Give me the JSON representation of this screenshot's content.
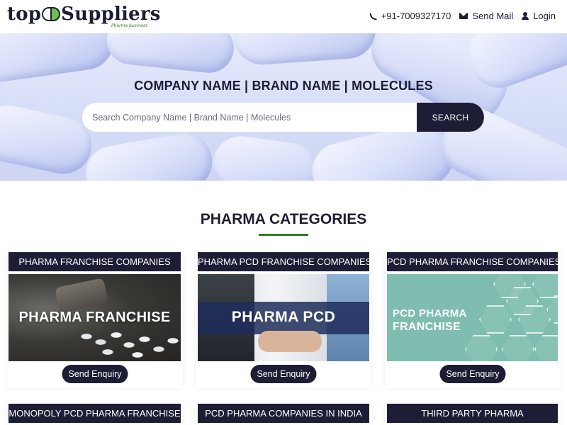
{
  "header": {
    "logo_left": "top",
    "logo_right": "Suppliers",
    "logo_tagline": "Pharma business",
    "phone": "+91-7009327170",
    "mail_label": "Send Mail",
    "login_label": "Login"
  },
  "hero": {
    "title": "COMPANY NAME | BRAND NAME | MOLECULES",
    "search_placeholder": "Search Company Name | Brand Name | Molecules",
    "search_button": "SEARCH"
  },
  "section": {
    "title": "PHARMA CATEGORIES"
  },
  "cards": [
    {
      "title": "PHARMA FRANCHISE COMPANIES",
      "image_text": "PHARMA FRANCHISE",
      "button": "Send Enquiry"
    },
    {
      "title": "PHARMA PCD FRANCHISE COMPANIES",
      "image_text": "PHARMA PCD",
      "button": "Send Enquiry"
    },
    {
      "title": "PCD PHARMA FRANCHISE COMPANIES",
      "image_text_line1": "PCD PHARMA",
      "image_text_line2": "FRANCHISE",
      "button": "Send Enquiry"
    },
    {
      "title": "MONOPOLY PCD PHARMA FRANCHISE"
    },
    {
      "title": "PCD PHARMA COMPANIES IN INDIA"
    },
    {
      "title": "THIRD PARTY PHARMA"
    }
  ],
  "colors": {
    "navy": "#1d1d35",
    "green_accent": "#2f7d1f",
    "hero_bg": "#d6ddf7",
    "card3_bg": "#7ebdaf"
  }
}
